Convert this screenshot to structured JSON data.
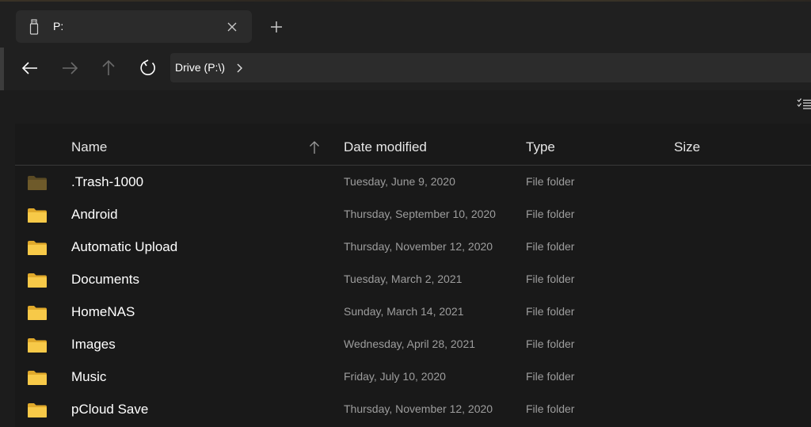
{
  "tab": {
    "title": "P:",
    "icon": "usb-drive-icon",
    "close_icon": "close-icon"
  },
  "new_tab_icon": "plus-icon",
  "nav": {
    "back_icon": "arrow-left-icon",
    "forward_icon": "arrow-right-icon",
    "up_icon": "arrow-up-icon",
    "refresh_icon": "refresh-icon"
  },
  "address": {
    "breadcrumb": "Drive (P:\\)",
    "chevron_icon": "chevron-right-icon"
  },
  "commandbar": {
    "view_icon": "details-view-icon"
  },
  "columns": {
    "name": "Name",
    "date": "Date modified",
    "type": "Type",
    "size": "Size",
    "sort_icon": "sort-ascending-icon"
  },
  "files": [
    {
      "name": ".Trash-1000",
      "date": "Tuesday, June 9, 2020",
      "type": "File folder",
      "size": "",
      "hidden": true
    },
    {
      "name": "Android",
      "date": "Thursday, September 10, 2020",
      "type": "File folder",
      "size": ""
    },
    {
      "name": "Automatic Upload",
      "date": "Thursday, November 12, 2020",
      "type": "File folder",
      "size": ""
    },
    {
      "name": "Documents",
      "date": "Tuesday, March 2, 2021",
      "type": "File folder",
      "size": ""
    },
    {
      "name": "HomeNAS",
      "date": "Sunday, March 14, 2021",
      "type": "File folder",
      "size": ""
    },
    {
      "name": "Images",
      "date": "Wednesday, April 28, 2021",
      "type": "File folder",
      "size": ""
    },
    {
      "name": "Music",
      "date": "Friday, July 10, 2020",
      "type": "File folder",
      "size": ""
    },
    {
      "name": "pCloud Save",
      "date": "Thursday, November 12, 2020",
      "type": "File folder",
      "size": ""
    }
  ],
  "colors": {
    "folder": "#f7c948",
    "folder_back": "#e0a92b",
    "folder_hidden": "#6e5a2a",
    "folder_hidden_back": "#5a4a24",
    "secondary_text": "#9d9d9d",
    "disabled_icon": "#6a6a6a"
  }
}
